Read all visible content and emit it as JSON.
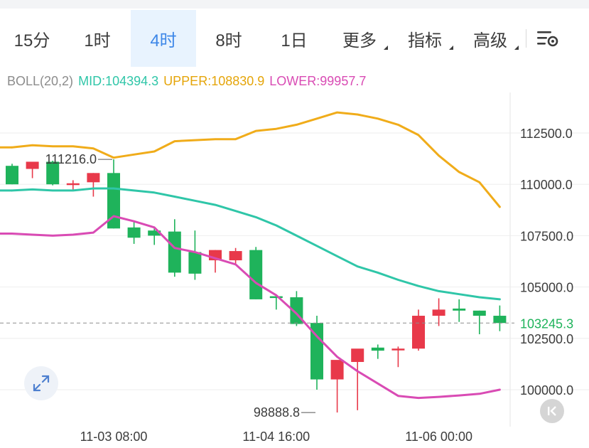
{
  "toolbar": {
    "tabs": [
      {
        "label": "15分",
        "active": false,
        "dropdown": false
      },
      {
        "label": "1时",
        "active": false,
        "dropdown": false
      },
      {
        "label": "4时",
        "active": true,
        "dropdown": false
      },
      {
        "label": "8时",
        "active": false,
        "dropdown": false
      },
      {
        "label": "1日",
        "active": false,
        "dropdown": false
      },
      {
        "label": "更多",
        "active": false,
        "dropdown": true
      },
      {
        "label": "指标",
        "active": false,
        "dropdown": true
      },
      {
        "label": "高级",
        "active": false,
        "dropdown": true
      }
    ],
    "settings_icon": "chart-settings-icon"
  },
  "indicator": {
    "name": "BOLL(20,2)",
    "mid": "MID:104394.3",
    "upper": "UPPER:108830.9",
    "lower": "LOWER:99957.7"
  },
  "colors": {
    "up": "#e8394a",
    "down": "#1fb35b",
    "mid": "#2fc6a8",
    "upper": "#f0ac1a",
    "lower": "#d94bb4",
    "accent": "#3d87e8"
  },
  "chart_data": {
    "type": "candlestick",
    "ylim": [
      98700,
      115000
    ],
    "yticks": [
      "112500.0",
      "110000.0",
      "107500.0",
      "105000.0",
      "102500.0",
      "100000.0"
    ],
    "ytick_values": [
      112500,
      110000,
      107500,
      105000,
      102500,
      100000
    ],
    "xticks": [
      "11-03 08:00",
      "11-04 16:00",
      "11-06 00:00"
    ],
    "xtick_candle_index": [
      5,
      13,
      21
    ],
    "current_price": "103245.3",
    "current_price_value": 103245.3,
    "annotations": [
      {
        "text": "111216.0",
        "candle_index": 5,
        "value": 111216.0,
        "side": "left"
      },
      {
        "text": "98888.8",
        "candle_index": 15,
        "value": 98888.8,
        "side": "left"
      }
    ],
    "candles": [
      {
        "o": 110900,
        "h": 111000,
        "l": 110000,
        "c": 110000
      },
      {
        "o": 110750,
        "h": 110800,
        "l": 110300,
        "c": 111100
      },
      {
        "o": 111100,
        "h": 111150,
        "l": 109950,
        "c": 110000
      },
      {
        "o": 110000,
        "h": 110200,
        "l": 109750,
        "c": 110050
      },
      {
        "o": 110100,
        "h": 110550,
        "l": 109400,
        "c": 110550
      },
      {
        "o": 110550,
        "h": 111216,
        "l": 107850,
        "c": 107850
      },
      {
        "o": 107900,
        "h": 108200,
        "l": 107100,
        "c": 107400
      },
      {
        "o": 107750,
        "h": 107900,
        "l": 107050,
        "c": 107500
      },
      {
        "o": 107700,
        "h": 108300,
        "l": 105500,
        "c": 105700
      },
      {
        "o": 106700,
        "h": 107750,
        "l": 105350,
        "c": 105650
      },
      {
        "o": 106300,
        "h": 106800,
        "l": 105700,
        "c": 106800
      },
      {
        "o": 106300,
        "h": 106900,
        "l": 106100,
        "c": 106750
      },
      {
        "o": 106800,
        "h": 106950,
        "l": 104400,
        "c": 104400
      },
      {
        "o": 104550,
        "h": 104600,
        "l": 103900,
        "c": 104500
      },
      {
        "o": 104500,
        "h": 104800,
        "l": 103100,
        "c": 103200
      },
      {
        "o": 103250,
        "h": 103600,
        "l": 100000,
        "c": 100500
      },
      {
        "o": 100500,
        "h": 101400,
        "l": 98888.8,
        "c": 101450
      },
      {
        "o": 101350,
        "h": 101350,
        "l": 99000,
        "c": 102000
      },
      {
        "o": 102050,
        "h": 102200,
        "l": 101500,
        "c": 101900
      },
      {
        "o": 101950,
        "h": 102100,
        "l": 101100,
        "c": 102000
      },
      {
        "o": 102000,
        "h": 103900,
        "l": 101900,
        "c": 103600
      },
      {
        "o": 103600,
        "h": 104450,
        "l": 103100,
        "c": 103900
      },
      {
        "o": 103950,
        "h": 104400,
        "l": 103300,
        "c": 103850
      },
      {
        "o": 103850,
        "h": 103850,
        "l": 102700,
        "c": 103600
      },
      {
        "o": 103600,
        "h": 104100,
        "l": 102850,
        "c": 103245.3
      }
    ],
    "series": [
      {
        "key": "upper",
        "values": [
          111800,
          111900,
          111850,
          111850,
          111750,
          111300,
          111450,
          111600,
          112100,
          112150,
          112200,
          112200,
          112600,
          112700,
          112900,
          113200,
          113500,
          113400,
          113200,
          112900,
          112400,
          111400,
          110600,
          110100,
          108900
        ]
      },
      {
        "key": "mid",
        "values": [
          109700,
          109750,
          109700,
          109700,
          109800,
          109800,
          109700,
          109600,
          109400,
          109200,
          109000,
          108700,
          108400,
          108000,
          107500,
          107000,
          106500,
          106000,
          105700,
          105350,
          105050,
          104800,
          104650,
          104500,
          104400
        ]
      },
      {
        "key": "lower",
        "values": [
          107600,
          107550,
          107500,
          107550,
          107650,
          108450,
          108200,
          107900,
          106900,
          106700,
          106400,
          106100,
          105200,
          104600,
          103700,
          102600,
          101600,
          100900,
          100300,
          99700,
          99600,
          99650,
          99720,
          99800,
          100000
        ]
      }
    ]
  }
}
